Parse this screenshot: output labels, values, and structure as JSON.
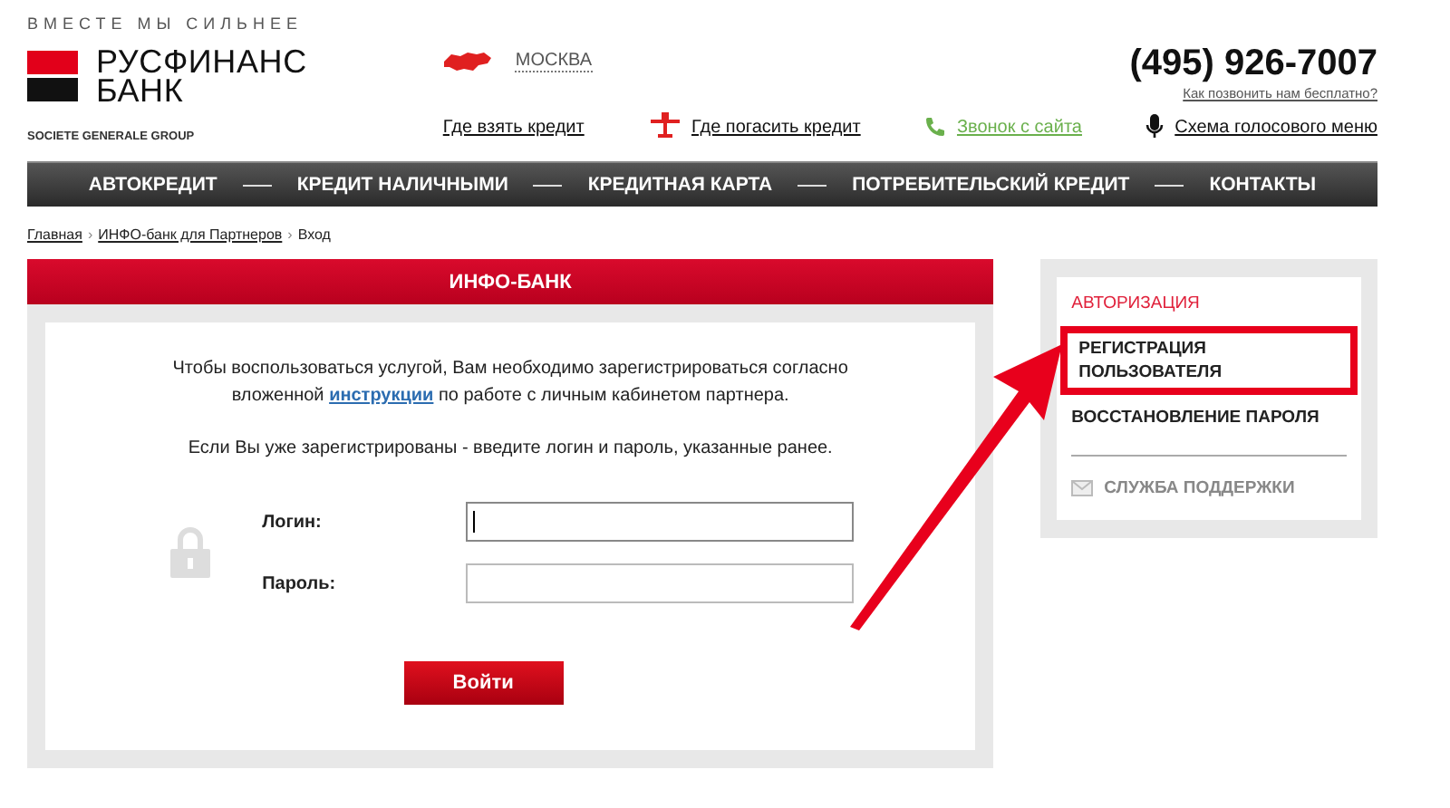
{
  "header": {
    "tagline": "ВМЕСТЕ МЫ СИЛЬНЕЕ",
    "logo_line_1": "РУСФИНАНС",
    "logo_line_2": "БАНК",
    "group": "SOCIETE GENERALE GROUP",
    "city": "МОСКВА",
    "phone": "(495) 926-7007",
    "phone_hint": "Как позвонить нам бесплатно?",
    "links": [
      {
        "kind": "plain",
        "label": "Где взять кредит"
      },
      {
        "kind": "plane",
        "label": "Где погасить кредит"
      },
      {
        "kind": "phone",
        "label": "Звонок с сайта"
      },
      {
        "kind": "mic",
        "label": "Схема голосового меню"
      }
    ]
  },
  "nav": [
    "АВТОКРЕДИТ",
    "КРЕДИТ НАЛИЧНЫМИ",
    "КРЕДИТНАЯ КАРТА",
    "ПОТРЕБИТЕЛЬСКИЙ КРЕДИТ",
    "КОНТАКТЫ"
  ],
  "breadcrumb_separator": "›",
  "breadcrumbs": [
    {
      "label": "Главная",
      "link": true
    },
    {
      "label": "ИНФО-банк для Партнеров",
      "link": true
    },
    {
      "label": "Вход",
      "link": false
    }
  ],
  "panel": {
    "title": "ИНФО-БАНК",
    "intro": "Чтобы воспользоваться услугой, Вам необходимо зарегистрироваться согласно вложенной",
    "intro_link": "инструкции",
    "intro_end": "по работе с личным кабинетом партнера.",
    "note": "Если Вы уже зарегистрированы - введите логин и пароль, указанные ранее.",
    "fields": [
      {
        "label": "Логин:",
        "focused": true
      },
      {
        "label": "Пароль:",
        "focused": false
      }
    ],
    "submit": "Войти"
  },
  "sidebar": {
    "items": [
      {
        "label": "АВТОРИЗАЦИЯ",
        "selected": true,
        "highlighted": false
      },
      {
        "label": "РЕГИСТРАЦИЯ ПОЛЬЗОВАТЕЛЯ",
        "selected": false,
        "highlighted": true
      },
      {
        "label": "ВОССТАНОВЛЕНИЕ ПАРОЛЯ",
        "selected": false,
        "highlighted": false
      }
    ],
    "support": "СЛУЖБА ПОДДЕРЖКИ"
  },
  "annotation": {
    "arrow": true
  }
}
